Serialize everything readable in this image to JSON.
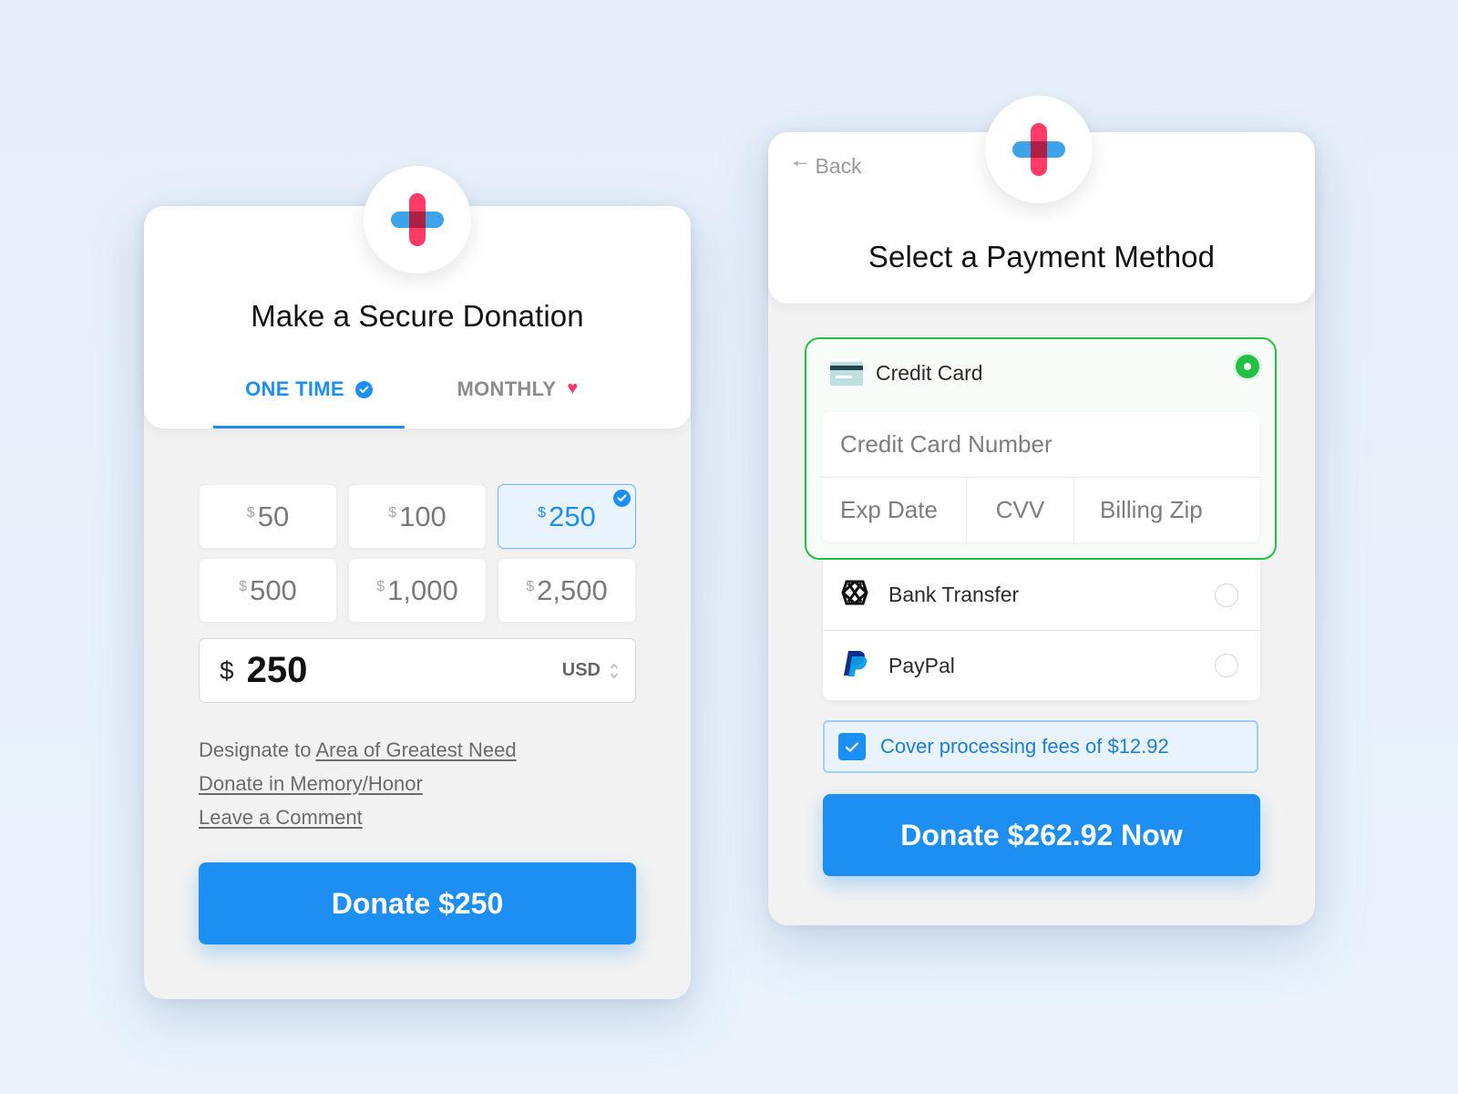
{
  "brand": {
    "logo_icon": "plus-cross-logo-icon",
    "colors": {
      "primary_blue": "#1e8ff2",
      "logo_blue": "#3ea4ea",
      "logo_pink": "#ff3b68",
      "success_green": "#22c045"
    }
  },
  "donation_card": {
    "title": "Make a Secure Donation",
    "tabs": [
      {
        "label": "ONE TIME",
        "icon": "check-circle-icon",
        "active": true
      },
      {
        "label": "MONTHLY",
        "icon": "heart-icon",
        "active": false
      }
    ],
    "currency_symbol": "$",
    "amounts": [
      {
        "value": "50",
        "selected": false
      },
      {
        "value": "100",
        "selected": false
      },
      {
        "value": "250",
        "selected": true
      },
      {
        "value": "500",
        "selected": false
      },
      {
        "value": "1,000",
        "selected": false
      },
      {
        "value": "2,500",
        "selected": false
      }
    ],
    "amount_input": {
      "symbol": "$",
      "value": "250",
      "currency": "USD"
    },
    "designate_prefix": "Designate to",
    "designate_link": "Area of Greatest Need",
    "memory_link": "Donate in Memory/Honor",
    "comment_link": "Leave a Comment",
    "donate_button": "Donate $250"
  },
  "payment_card": {
    "back_label": "Back",
    "title": "Select a Payment Method",
    "methods": [
      {
        "label": "Credit Card",
        "icon": "credit-card-icon",
        "selected": true
      },
      {
        "label": "Bank Transfer",
        "icon": "bank-transfer-icon",
        "selected": false
      },
      {
        "label": "PayPal",
        "icon": "paypal-icon",
        "selected": false
      }
    ],
    "card_fields": {
      "number_placeholder": "Credit Card Number",
      "exp_placeholder": "Exp Date",
      "cvv_placeholder": "CVV",
      "zip_placeholder": "Billing Zip"
    },
    "cover_fees": {
      "checked": true,
      "label": "Cover processing fees of $12.92"
    },
    "donate_button": "Donate $262.92 Now"
  }
}
